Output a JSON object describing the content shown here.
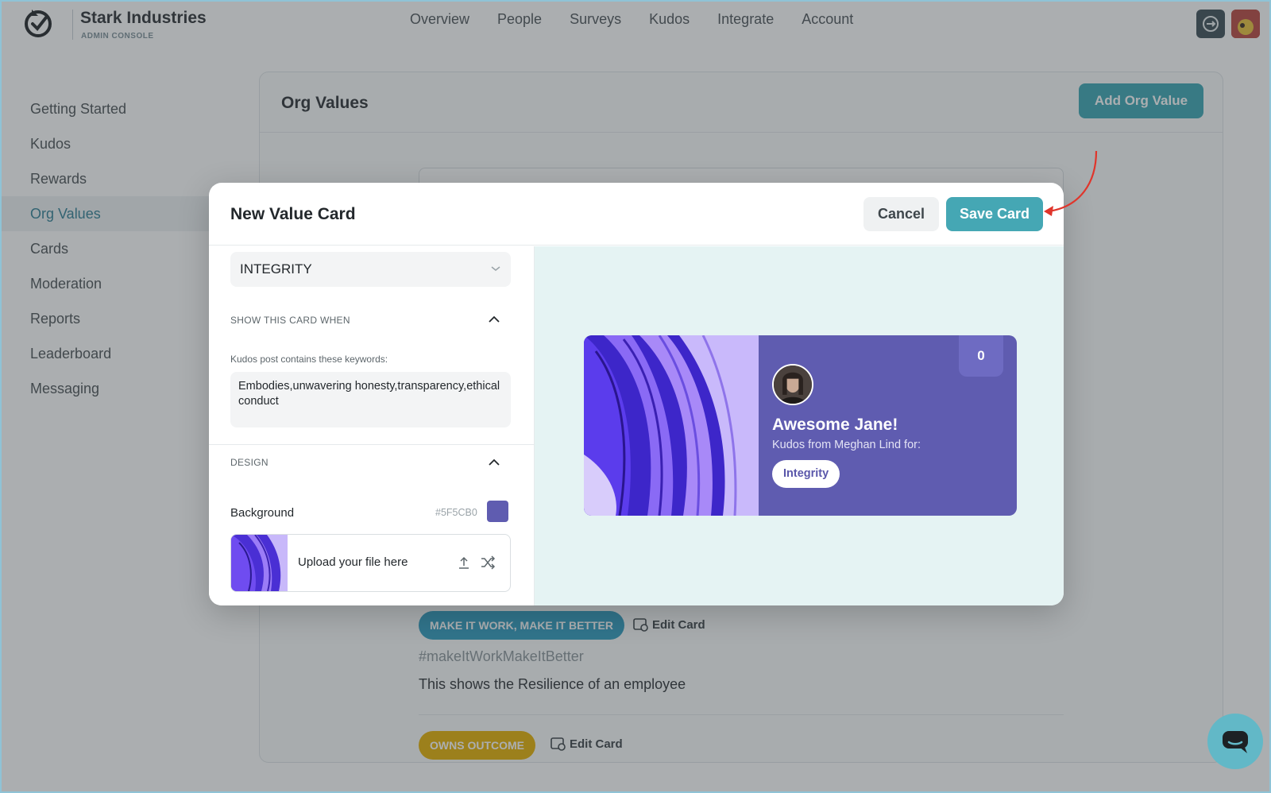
{
  "header": {
    "brand_name": "Stark Industries",
    "brand_sub": "ADMIN CONSOLE",
    "nav": [
      "Overview",
      "People",
      "Surveys",
      "Kudos",
      "Integrate",
      "Account"
    ]
  },
  "sidebar": {
    "items": [
      {
        "label": "Getting Started"
      },
      {
        "label": "Kudos"
      },
      {
        "label": "Rewards"
      },
      {
        "label": "Org Values",
        "active": true
      },
      {
        "label": "Cards"
      },
      {
        "label": "Moderation"
      },
      {
        "label": "Reports"
      },
      {
        "label": "Leaderboard"
      },
      {
        "label": "Messaging"
      }
    ]
  },
  "main": {
    "title": "Org Values",
    "add_button": "Add Org Value",
    "cards": [
      {
        "tag": "MAKE IT WORK, MAKE IT BETTER",
        "edit_label": "Edit Card",
        "hashtag": "#makeItWorkMakeItBetter",
        "description": "This shows the Resilience of an employee"
      },
      {
        "tag": "OWNS OUTCOME",
        "edit_label": "Edit Card"
      }
    ]
  },
  "modal": {
    "title": "New Value Card",
    "cancel_label": "Cancel",
    "save_label": "Save Card",
    "value_select": "INTEGRITY",
    "show_when_label": "SHOW THIS CARD WHEN",
    "keywords_label": "Kudos post contains these keywords:",
    "keywords_value": "Embodies,unwavering honesty,transparency,ethical conduct",
    "design_label": "DESIGN",
    "background_label": "Background",
    "background_hex": "#5F5CB0",
    "upload_label": "Upload your file here"
  },
  "preview": {
    "count": "0",
    "title": "Awesome Jane!",
    "from": "Kudos from Meghan Lind for:",
    "value_pill": "Integrity"
  },
  "colors": {
    "accent": "#45a7b4",
    "card_background": "#5F5CB0",
    "annotation_arrow": "#e0352b"
  }
}
